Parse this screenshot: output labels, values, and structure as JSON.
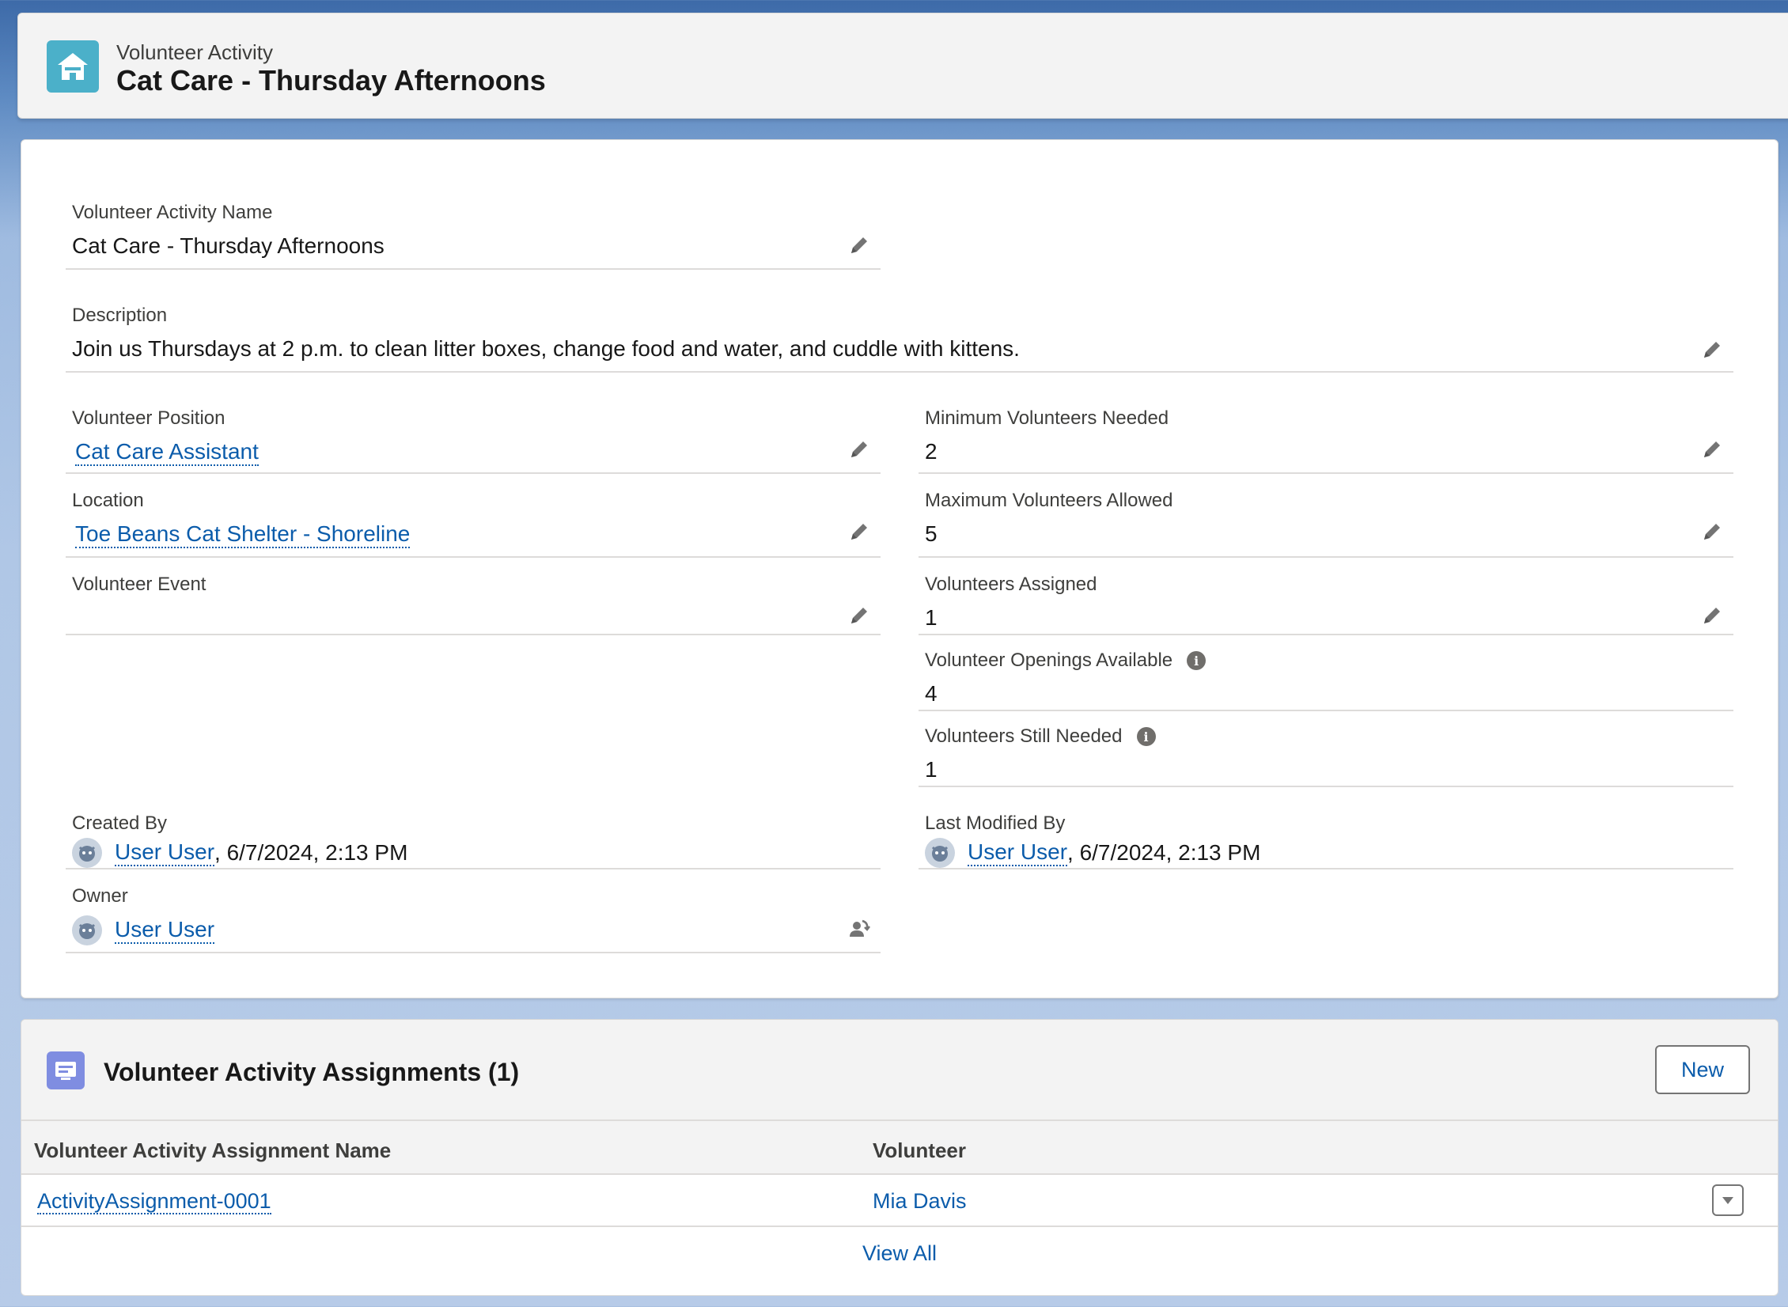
{
  "header": {
    "object_label": "Volunteer Activity",
    "record_title": "Cat Care - Thursday Afternoons"
  },
  "fields": {
    "name": {
      "label": "Volunteer Activity Name",
      "value": "Cat Care - Thursday Afternoons"
    },
    "description": {
      "label": "Description",
      "value": "Join us Thursdays at 2 p.m. to clean litter boxes, change food and water, and cuddle with kittens."
    },
    "position": {
      "label": "Volunteer Position",
      "value": "Cat Care Assistant"
    },
    "location": {
      "label": "Location",
      "value": "Toe Beans Cat Shelter - Shoreline"
    },
    "event": {
      "label": "Volunteer Event",
      "value": ""
    },
    "min_needed": {
      "label": "Minimum Volunteers Needed",
      "value": "2"
    },
    "max_allowed": {
      "label": "Maximum Volunteers Allowed",
      "value": "5"
    },
    "assigned": {
      "label": "Volunteers Assigned",
      "value": "1"
    },
    "openings": {
      "label": "Volunteer Openings Available",
      "value": "4"
    },
    "still_needed": {
      "label": "Volunteers Still Needed",
      "value": "1"
    },
    "created_by": {
      "label": "Created By",
      "user": "User User",
      "date": ", 6/7/2024, 2:13 PM"
    },
    "modified_by": {
      "label": "Last Modified By",
      "user": "User User",
      "date": ", 6/7/2024, 2:13 PM"
    },
    "owner": {
      "label": "Owner",
      "user": "User User"
    }
  },
  "related": {
    "title": "Volunteer Activity Assignments (1)",
    "new_label": "New",
    "columns": [
      "Volunteer Activity Assignment Name",
      "Volunteer"
    ],
    "rows": [
      {
        "name": "ActivityAssignment-0001",
        "volunteer": "Mia Davis"
      }
    ],
    "view_all": "View All"
  },
  "icons": {
    "header": "home-icon",
    "related": "assignment-icon",
    "edit": "pencil-icon",
    "info": "info-icon",
    "owner_change": "change-owner-icon",
    "avatar": "user-avatar-icon",
    "row_menu": "chevron-down-icon"
  },
  "colors": {
    "link": "#0b5cab",
    "header_icon_bg": "#4bb0c9",
    "related_icon_bg": "#7f8de1"
  }
}
